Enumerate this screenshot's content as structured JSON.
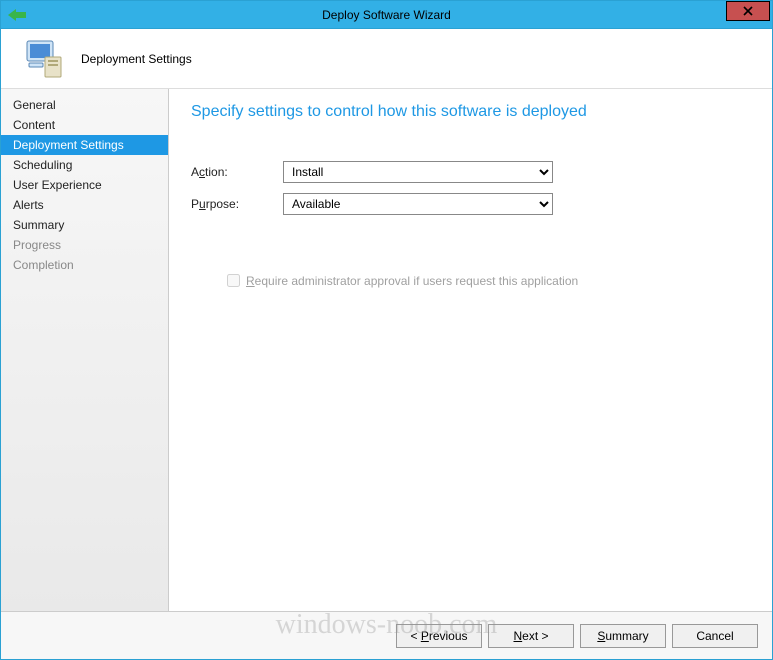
{
  "window": {
    "title": "Deploy Software Wizard"
  },
  "header": {
    "label": "Deployment Settings"
  },
  "sidebar": {
    "items": [
      {
        "label": "General",
        "selected": false,
        "muted": false
      },
      {
        "label": "Content",
        "selected": false,
        "muted": false
      },
      {
        "label": "Deployment Settings",
        "selected": true,
        "muted": false
      },
      {
        "label": "Scheduling",
        "selected": false,
        "muted": false
      },
      {
        "label": "User Experience",
        "selected": false,
        "muted": false
      },
      {
        "label": "Alerts",
        "selected": false,
        "muted": false
      },
      {
        "label": "Summary",
        "selected": false,
        "muted": false
      },
      {
        "label": "Progress",
        "selected": false,
        "muted": true
      },
      {
        "label": "Completion",
        "selected": false,
        "muted": true
      }
    ]
  },
  "main": {
    "title": "Specify settings to control how this software is deployed",
    "action": {
      "label_pre": "A",
      "label_ul": "c",
      "label_post": "tion:",
      "value": "Install"
    },
    "purpose": {
      "label_pre": "P",
      "label_ul": "u",
      "label_post": "rpose:",
      "value": "Available"
    },
    "approval": {
      "label_ul": "R",
      "label_post": "equire administrator approval if users request this application",
      "checked": false,
      "disabled": true
    }
  },
  "footer": {
    "previous": {
      "pre": "< ",
      "ul": "P",
      "post": "revious"
    },
    "next": {
      "pre": "",
      "ul": "N",
      "post": "ext >"
    },
    "summary": {
      "pre": "",
      "ul": "S",
      "post": "ummary"
    },
    "cancel": {
      "pre": "",
      "ul": "",
      "post": "Cancel"
    }
  },
  "watermark": "windows-noob.com"
}
